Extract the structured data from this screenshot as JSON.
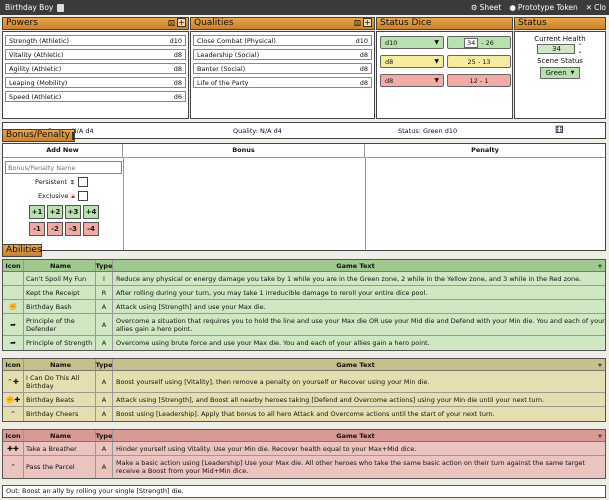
{
  "titlebar": {
    "title": "Birthday Boy",
    "sheet_label": "Sheet",
    "prototype_label": "Prototype Token",
    "close_label": "Clo"
  },
  "powers": {
    "header": "Powers",
    "items": [
      {
        "name": "Strength (Athletic)",
        "die": "d10"
      },
      {
        "name": "Vitality (Athletic)",
        "die": "d8"
      },
      {
        "name": "Agility (Athletic)",
        "die": "d8"
      },
      {
        "name": "Leaping (Mobility)",
        "die": "d8"
      },
      {
        "name": "Speed (Athletic)",
        "die": "d6"
      }
    ]
  },
  "qualities": {
    "header": "Qualities",
    "items": [
      {
        "name": "Close Combat (Physical)",
        "die": "d10"
      },
      {
        "name": "Leadership (Social)",
        "die": "d8"
      },
      {
        "name": "Banter (Social)",
        "die": "d8"
      },
      {
        "name": "Life of the Party",
        "die": "d8"
      }
    ]
  },
  "status_dice": {
    "header": "Status Dice",
    "green_die": "d10",
    "green_low": "34",
    "green_high": "26",
    "yellow_die": "d8",
    "yellow_range": "25 - 13",
    "red_die": "d8",
    "red_range": "12 - 1"
  },
  "status": {
    "header": "Status",
    "health_label": "Current Health",
    "health_value": "34",
    "scene_label": "Scene Status",
    "scene_value": "Green"
  },
  "info": {
    "power": "Power: N/A d4",
    "quality": "Quality: N/A d4",
    "status": "Status: Green d10"
  },
  "bonus_penalty": {
    "header": "Bonus/Penalty",
    "add_new": "Add New",
    "bonus": "Bonus",
    "penalty": "Penalty",
    "name_placeholder": "Bonus/Penalty Name",
    "persistent": "Persistent",
    "exclusive": "Exclusive",
    "plus": [
      "+1",
      "+2",
      "+3",
      "+4"
    ],
    "minus": [
      "-1",
      "-2",
      "-3",
      "-4"
    ]
  },
  "abilities": {
    "header": "Abilities",
    "cols": {
      "icon": "Icon",
      "name": "Name",
      "type": "Type",
      "text": "Game Text"
    },
    "green": [
      {
        "icon": "",
        "name": "Can't Spoil My Fun",
        "type": "I",
        "text": "Reduce any physical or energy damage you take by 1 while you are in the Green zone, 2 while in the Yellow zone, and 3 while in the Red zone."
      },
      {
        "icon": "",
        "name": "Kept the Receipt",
        "type": "R",
        "text": "After rolling during your turn, you may take 1 irreducible damage to reroll your entire dice pool."
      },
      {
        "icon": "✊",
        "name": "Birthday Bash",
        "type": "A",
        "text": "Attack using [Strength] and use your Max die."
      },
      {
        "icon": "➦",
        "name": "Principle of the Defender",
        "type": "A",
        "text": "Overcome a situation that requires you to hold the line and use your Max die OR use your Mid die and Defend with your Min die. You and each of your allies gain a hero point."
      },
      {
        "icon": "➦",
        "name": "Principle of Strength",
        "type": "A",
        "text": "Overcome using brute force and use your Max die. You and each of your allies gain a hero point."
      }
    ],
    "yellow": [
      {
        "icon": "⌃✚",
        "name": "I Can Do This All Birthday",
        "type": "A",
        "text": "Boost yourself using [Vitality], then remove a penalty on yourself or Recover using your Min die."
      },
      {
        "icon": "✊✚",
        "name": "Birthday Beats",
        "type": "A",
        "text": "Attack using [Strength], and Boost all nearby heroes taking [Defend and Overcome actions] using your Min die until your next turn."
      },
      {
        "icon": "⌃",
        "name": "Birthday Cheers",
        "type": "A",
        "text": "Boost using [Leadership]. Apply that bonus to all hero Attack and Overcome actions until the start of your next turn."
      }
    ],
    "red": [
      {
        "icon": "✚✚",
        "name": "Take a Breather",
        "type": "A",
        "text": "Hinder yourself using Vitality. Use your Min die. Recover health equal to your Max+Mid dice."
      },
      {
        "icon": "⌃",
        "name": "Pass the Parcel",
        "type": "A",
        "text": "Make a basic action using [Leadership] Use your Max die. All other heroes who take the same basic action on their turn against the same target receive a Boost from your Mid+Min dice."
      }
    ],
    "out": "Out: Boost an ally by rolling your single [Strength] die."
  },
  "colors": {
    "header_orange": "#d8902f",
    "green_zone": "#b9e1b0",
    "yellow_zone": "#f6ec9e",
    "red_zone": "#f2aaa4"
  }
}
